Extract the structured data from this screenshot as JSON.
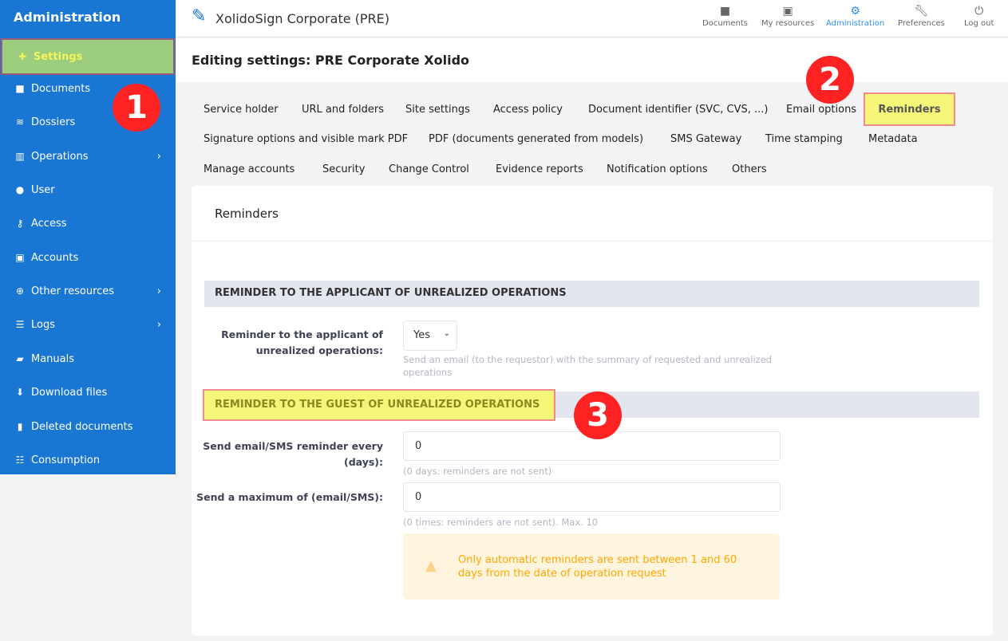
{
  "sidebar": {
    "title": "Administration",
    "items": [
      {
        "label": "Settings",
        "icon": "puzzle-icon",
        "active": true
      },
      {
        "label": "Documents",
        "icon": "folder-icon"
      },
      {
        "label": "Dossiers",
        "icon": "layers-icon"
      },
      {
        "label": "Operations",
        "icon": "chart-icon",
        "submenu": true
      },
      {
        "label": "User",
        "icon": "user-icon"
      },
      {
        "label": "Access",
        "icon": "key-icon"
      },
      {
        "label": "Accounts",
        "icon": "id-card-icon"
      },
      {
        "label": "Other resources",
        "icon": "plus-circle-icon",
        "submenu": true
      },
      {
        "label": "Logs",
        "icon": "list-icon",
        "submenu": true
      },
      {
        "label": "Manuals",
        "icon": "book-icon"
      },
      {
        "label": "Download files",
        "icon": "download-icon"
      },
      {
        "label": "Deleted documents",
        "icon": "trash-icon"
      },
      {
        "label": "Consumption",
        "icon": "table-icon"
      }
    ]
  },
  "header": {
    "app_title": "XolidoSign Corporate (PRE)",
    "nav": [
      {
        "label": "Documents",
        "icon": "folder-icon"
      },
      {
        "label": "My resources",
        "icon": "id-card-icon"
      },
      {
        "label": "Administration",
        "icon": "gear-icon",
        "active": true
      },
      {
        "label": "Preferences",
        "icon": "wrench-icon"
      },
      {
        "label": "Log out",
        "icon": "power-icon"
      }
    ]
  },
  "page_title": "Editing settings: PRE Corporate Xolido",
  "tabs": [
    "Service holder",
    "URL and folders",
    "Site settings",
    "Access policy",
    "Document identifier (SVC, CVS, ...)",
    "Email options",
    "Reminders",
    "Signature options and visible mark PDF",
    "PDF (documents generated from models)",
    "SMS Gateway",
    "Time stamping",
    "Metadata",
    "Manage accounts",
    "Security",
    "Change Control",
    "Evidence reports",
    "Notification options",
    "Others"
  ],
  "card": {
    "title": "Reminders",
    "section1": {
      "title": "REMINDER TO THE APPLICANT OF UNREALIZED OPERATIONS",
      "label": "Reminder to the applicant of unrealized operations:",
      "value": "Yes",
      "help": "Send an email (to the requestor) with the summary of requested and unrealized operations"
    },
    "section2": {
      "title": "REMINDER TO THE GUEST OF UNREALIZED OPERATIONS",
      "field1": {
        "label": "Send email/SMS reminder every (days):",
        "value": "0",
        "help": "(0 days: reminders are not sent)"
      },
      "field2": {
        "label": "Send a maximum of (email/SMS):",
        "value": "0",
        "help": "(0 times: reminders are not sent). Max. 10"
      },
      "alert": "Only automatic reminders are sent between 1 and 60 days from the date of operation request"
    }
  },
  "annotations": [
    "1",
    "2",
    "3"
  ],
  "colors": {
    "sidebar": "#1976d2",
    "accent": "#2e8ff0",
    "highlight": "#f5f57a",
    "annotation": "#ff2222",
    "warning": "#ffa800"
  }
}
